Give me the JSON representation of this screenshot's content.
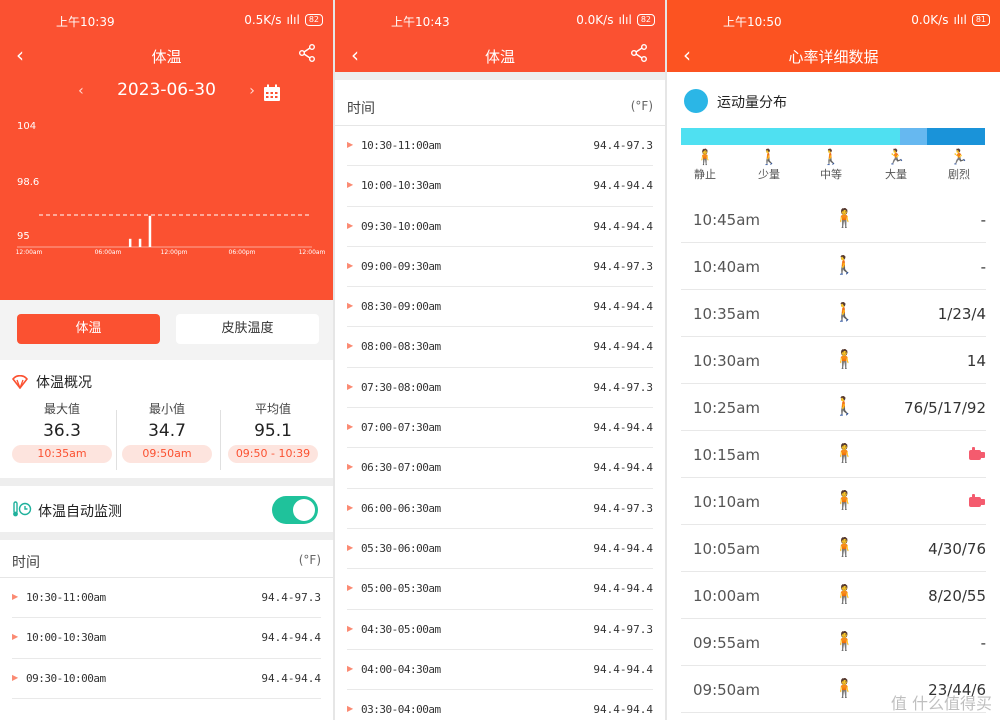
{
  "panel1": {
    "status": {
      "time": "上午10:39",
      "speed": "0.5K/s",
      "signal": "ılıl",
      "battery": "82"
    },
    "header": {
      "title": "体温"
    },
    "date": "2023-06-30",
    "chart_data": {
      "type": "bar",
      "y_ticks": [
        "104",
        "98.6",
        "95"
      ],
      "x_ticks": [
        "12:00 am",
        "06:00 am",
        "12:00 pm",
        "06:00 pm",
        "12:00 am"
      ],
      "reference_line": 98.6,
      "bars": [
        {
          "x": "10:00",
          "y": 94.5
        },
        {
          "x": "10:30",
          "y": 94.5
        },
        {
          "x": "11:00",
          "y": 97.3
        }
      ]
    },
    "tabs": {
      "active": "体温",
      "inactive": "皮肤温度"
    },
    "summary": {
      "title": "体温概况",
      "max": {
        "label": "最大值",
        "value": "36.3",
        "time": "10:35am"
      },
      "min": {
        "label": "最小值",
        "value": "34.7",
        "time": "09:50am"
      },
      "avg": {
        "label": "平均值",
        "value": "95.1",
        "time": "09:50 - 10:39"
      }
    },
    "monitor": {
      "label": "体温自动监测"
    },
    "list": {
      "head_left": "时间",
      "head_right": "(°F)",
      "rows": [
        {
          "t": "10:30-11:00am",
          "v": "94.4-97.3"
        },
        {
          "t": "10:00-10:30am",
          "v": "94.4-94.4"
        },
        {
          "t": "09:30-10:00am",
          "v": "94.4-94.4"
        }
      ]
    }
  },
  "panel2": {
    "status": {
      "time": "上午10:43",
      "speed": "0.0K/s",
      "signal": "ılıl",
      "battery": "82"
    },
    "header": {
      "title": "体温"
    },
    "list": {
      "head_left": "时间",
      "head_right": "(°F)",
      "rows": [
        {
          "t": "10:30-11:00am",
          "v": "94.4-97.3"
        },
        {
          "t": "10:00-10:30am",
          "v": "94.4-94.4"
        },
        {
          "t": "09:30-10:00am",
          "v": "94.4-94.4"
        },
        {
          "t": "09:00-09:30am",
          "v": "94.4-97.3"
        },
        {
          "t": "08:30-09:00am",
          "v": "94.4-94.4"
        },
        {
          "t": "08:00-08:30am",
          "v": "94.4-94.4"
        },
        {
          "t": "07:30-08:00am",
          "v": "94.4-97.3"
        },
        {
          "t": "07:00-07:30am",
          "v": "94.4-94.4"
        },
        {
          "t": "06:30-07:00am",
          "v": "94.4-94.4"
        },
        {
          "t": "06:00-06:30am",
          "v": "94.4-97.3"
        },
        {
          "t": "05:30-06:00am",
          "v": "94.4-94.4"
        },
        {
          "t": "05:00-05:30am",
          "v": "94.4-94.4"
        },
        {
          "t": "04:30-05:00am",
          "v": "94.4-97.3"
        },
        {
          "t": "04:00-04:30am",
          "v": "94.4-94.4"
        },
        {
          "t": "03:30-04:00am",
          "v": "94.4-94.4"
        }
      ]
    }
  },
  "panel3": {
    "status": {
      "time": "上午10:50",
      "speed": "0.0K/s",
      "signal": "ılıl",
      "battery": "81"
    },
    "header": {
      "title": "心率详细数据"
    },
    "distribution": {
      "title": "运动量分布",
      "segments": [
        {
          "level": "静止",
          "fraction": 0.72,
          "color": "#4fe0f1"
        },
        {
          "level": "少量",
          "fraction": 0.09,
          "color": "#66b8f0"
        },
        {
          "level": "中等",
          "fraction": 0.19,
          "color": "#1a93d9"
        }
      ],
      "levels": [
        {
          "name": "静止",
          "icon": "standing-person-icon",
          "glyph": "🧍",
          "color": "#36c7e8"
        },
        {
          "name": "少量",
          "icon": "walking-person-icon",
          "glyph": "🚶",
          "color": "#36c7e8"
        },
        {
          "name": "中等",
          "icon": "walking-person-icon",
          "glyph": "🚶",
          "color": "#1a6fd0"
        },
        {
          "name": "大量",
          "icon": "running-person-icon",
          "glyph": "🏃",
          "color": "#f4495c"
        },
        {
          "name": "剧烈",
          "icon": "running-person-icon",
          "glyph": "🏃",
          "color": "#f4495c"
        }
      ]
    },
    "rows": [
      {
        "t": "10:45am",
        "icon": "standing-person-icon",
        "glyph": "🧍",
        "color": "#36c7e8",
        "v": "-"
      },
      {
        "t": "10:40am",
        "icon": "walking-person-icon",
        "glyph": "🚶",
        "color": "#36c7e8",
        "v": "-"
      },
      {
        "t": "10:35am",
        "icon": "walking-person-icon",
        "glyph": "🚶",
        "color": "#1a6fd0",
        "v": "1/23/4"
      },
      {
        "t": "10:30am",
        "icon": "standing-person-icon",
        "glyph": "🧍",
        "color": "#36c7e8",
        "v": "14"
      },
      {
        "t": "10:25am",
        "icon": "walking-person-icon",
        "glyph": "🚶",
        "color": "#1a6fd0",
        "v": "76/5/17/92"
      },
      {
        "t": "10:15am",
        "icon": "standing-person-icon",
        "glyph": "🧍",
        "color": "#36c7e8",
        "v": "",
        "hand": true
      },
      {
        "t": "10:10am",
        "icon": "standing-person-icon",
        "glyph": "🧍",
        "color": "#36c7e8",
        "v": "",
        "hand": true
      },
      {
        "t": "10:05am",
        "icon": "standing-person-icon",
        "glyph": "🧍",
        "color": "#36c7e8",
        "v": "4/30/76"
      },
      {
        "t": "10:00am",
        "icon": "standing-person-icon",
        "glyph": "🧍",
        "color": "#36c7e8",
        "v": "8/20/55"
      },
      {
        "t": "09:55am",
        "icon": "standing-person-icon",
        "glyph": "🧍",
        "color": "#36c7e8",
        "v": "-"
      },
      {
        "t": "09:50am",
        "icon": "standing-person-icon",
        "glyph": "🧍",
        "color": "#36c7e8",
        "v": "23/44/6"
      }
    ],
    "watermark": "值 什么值得买"
  }
}
